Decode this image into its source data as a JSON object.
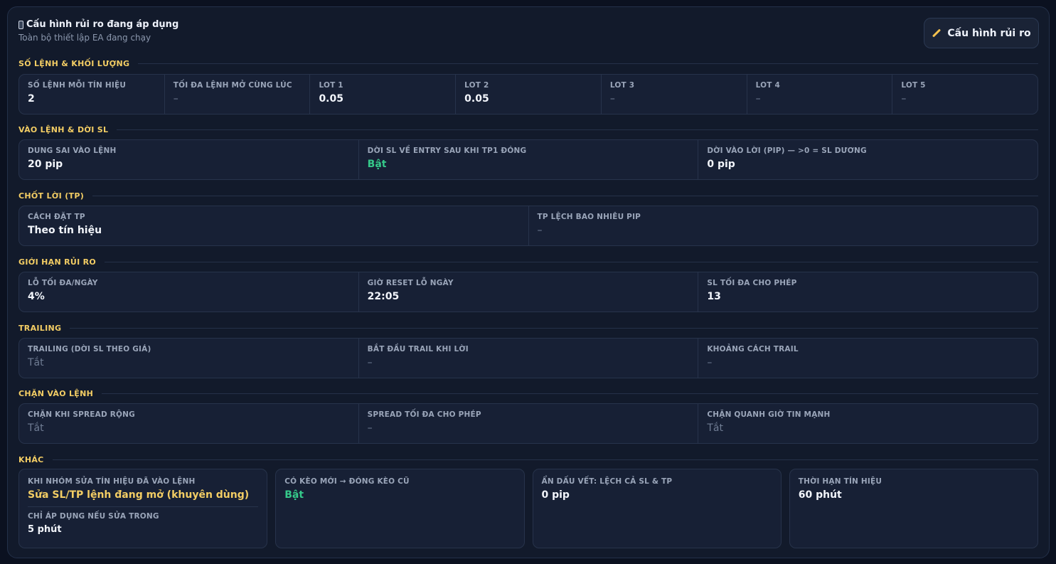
{
  "header": {
    "title": "Cấu hình rủi ro đang áp dụng",
    "subtitle": "Toàn bộ thiết lập EA đang chạy",
    "config_button": "Cấu hình rủi ro"
  },
  "sections": {
    "volume": {
      "heading": "SỐ LỆNH & KHỐI LƯỢNG",
      "items": [
        {
          "label": "SỐ LỆNH MỖI TÍN HIỆU",
          "value": "2"
        },
        {
          "label": "TỐI ĐA LỆNH MỞ CÙNG LÚC",
          "value": "–"
        },
        {
          "label": "LOT 1",
          "value": "0.05"
        },
        {
          "label": "LOT 2",
          "value": "0.05"
        },
        {
          "label": "LOT 3",
          "value": "–"
        },
        {
          "label": "LOT 4",
          "value": "–"
        },
        {
          "label": "LOT 5",
          "value": "–"
        }
      ]
    },
    "entry": {
      "heading": "VÀO LỆNH & DỜI SL",
      "items": [
        {
          "label": "DUNG SAI VÀO LỆNH",
          "value": "20 pip"
        },
        {
          "label": "DỜI SL VỀ ENTRY SAU KHI TP1 ĐÓNG",
          "value": "Bật"
        },
        {
          "label": "DỜI VÀO LỜI (PIP) — >0 = SL DƯƠNG",
          "value": "0 pip"
        }
      ]
    },
    "tp": {
      "heading": "CHỐT LỜI (TP)",
      "items": [
        {
          "label": "CÁCH ĐẶT TP",
          "value": "Theo tín hiệu"
        },
        {
          "label": "TP LỆCH BAO NHIÊU PIP",
          "value": "–"
        }
      ]
    },
    "risk": {
      "heading": "GIỚI HẠN RỦI RO",
      "items": [
        {
          "label": "LỖ TỐI ĐA/NGÀY",
          "value": "4%"
        },
        {
          "label": "GIỜ RESET LỖ NGÀY",
          "value": "22:05"
        },
        {
          "label": "SL TỐI ĐA CHO PHÉP",
          "value": "13"
        }
      ]
    },
    "trailing": {
      "heading": "TRAILING",
      "items": [
        {
          "label": "TRAILING (DỜI SL THEO GIÁ)",
          "value": "Tắt"
        },
        {
          "label": "BẮT ĐẦU TRAIL KHI LỜI",
          "value": "–"
        },
        {
          "label": "KHOẢNG CÁCH TRAIL",
          "value": "–"
        }
      ]
    },
    "block": {
      "heading": "CHẶN VÀO LỆNH",
      "items": [
        {
          "label": "CHẶN KHI SPREAD RỘNG",
          "value": "Tắt"
        },
        {
          "label": "SPREAD TỐI ĐA CHO PHÉP",
          "value": "–"
        },
        {
          "label": "CHẶN QUANH GIỜ TIN MẠNH",
          "value": "Tắt"
        }
      ]
    },
    "other": {
      "heading": "KHÁC",
      "edit": {
        "label": "KHI NHÓM SỬA TÍN HIỆU ĐÃ VÀO LỆNH",
        "value": "Sửa SL/TP lệnh đang mở (khuyên dùng)",
        "sub_label": "CHỈ ÁP DỤNG NẾU SỬA TRONG",
        "sub_value": "5 phút"
      },
      "new_close": {
        "label": "CÓ KÈO MỚI → ĐÓNG KÈO CŨ",
        "value": "Bật"
      },
      "hide": {
        "label": "ẨN DẤU VẾT: LỆCH CẢ SL & TP",
        "value": "0 pip"
      },
      "expiry": {
        "label": "THỜI HẠN TÍN HIỆU",
        "value": "60 phút"
      }
    }
  },
  "colors": {
    "accent": "#f3cd64",
    "on": "#35c98a",
    "muted": "#6f7c93",
    "background": "#0b1120",
    "panel": "#121a2b"
  }
}
